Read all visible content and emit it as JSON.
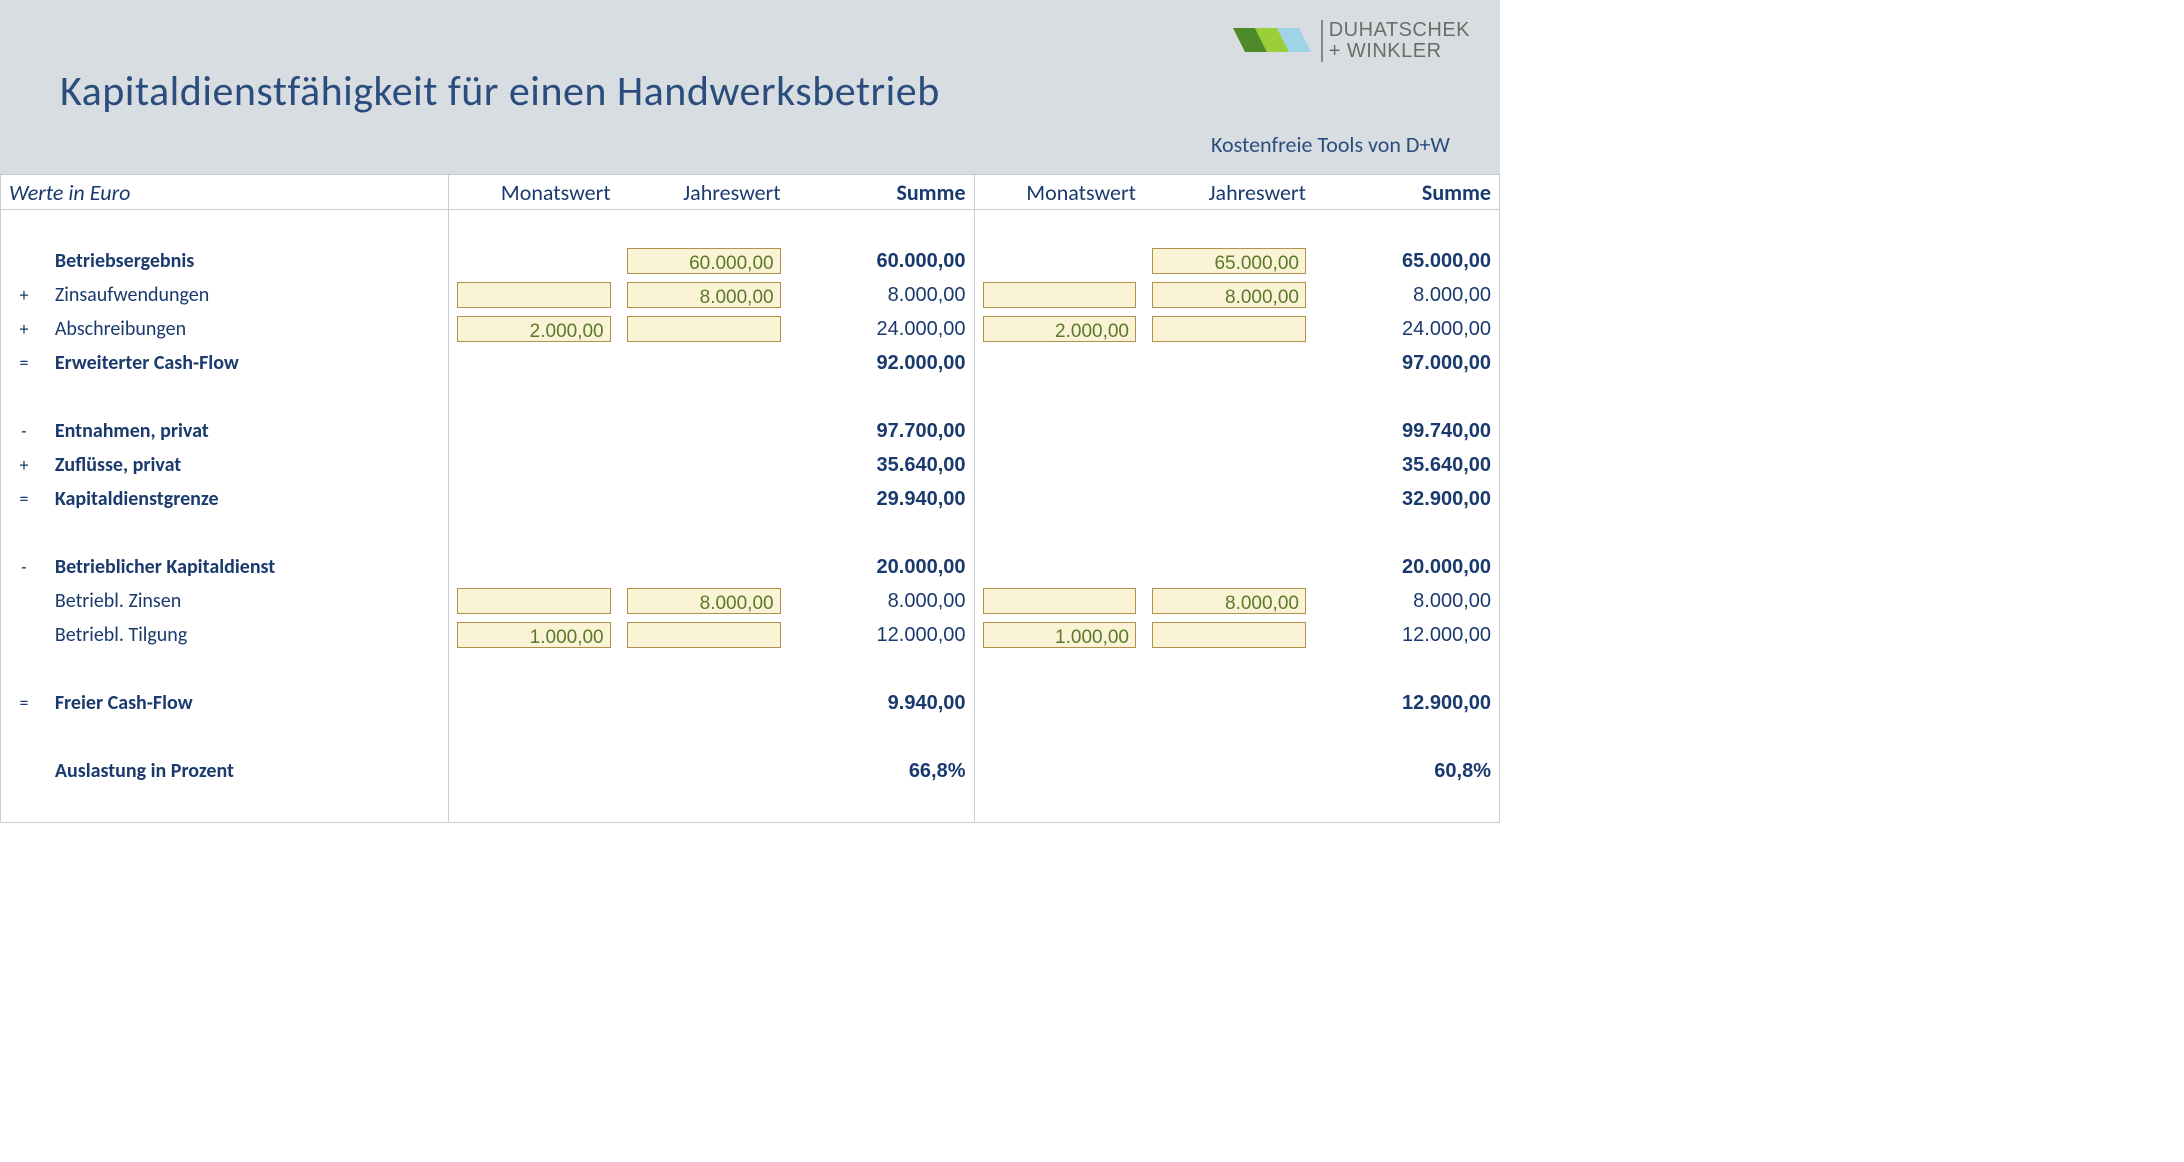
{
  "header": {
    "title": "Kapitaldienstfähigkeit für einen Handwerksbetrieb",
    "subtitle": "Kostenfreie Tools von D+W",
    "logo_line1": "DUHATSCHEK",
    "logo_line2": "+ WINKLER"
  },
  "columns": {
    "left_caption": "Werte in Euro",
    "monat": "Monatswert",
    "jahr": "Jahreswert",
    "summe": "Summe"
  },
  "rows": {
    "betriebsergebnis": {
      "op": "",
      "label": "Betriebsergebnis",
      "a": {
        "monat": "",
        "jahr": "60.000,00",
        "summe": "60.000,00"
      },
      "b": {
        "monat": "",
        "jahr": "65.000,00",
        "summe": "65.000,00"
      }
    },
    "zinsaufwendungen": {
      "op": "+",
      "label": "Zinsaufwendungen",
      "a": {
        "monat": "",
        "jahr": "8.000,00",
        "summe": "8.000,00"
      },
      "b": {
        "monat": "",
        "jahr": "8.000,00",
        "summe": "8.000,00"
      }
    },
    "abschreibungen": {
      "op": "+",
      "label": "Abschreibungen",
      "a": {
        "monat": "2.000,00",
        "jahr": "",
        "summe": "24.000,00"
      },
      "b": {
        "monat": "2.000,00",
        "jahr": "",
        "summe": "24.000,00"
      }
    },
    "erweiterter_cf": {
      "op": "=",
      "label": "Erweiterter Cash-Flow",
      "a": {
        "summe": "92.000,00"
      },
      "b": {
        "summe": "97.000,00"
      }
    },
    "entnahmen": {
      "op": "-",
      "label": "Entnahmen, privat",
      "a": {
        "summe": "97.700,00"
      },
      "b": {
        "summe": "99.740,00"
      }
    },
    "zufluesse": {
      "op": "+",
      "label": "Zuflüsse, privat",
      "a": {
        "summe": "35.640,00"
      },
      "b": {
        "summe": "35.640,00"
      }
    },
    "kapitaldienstgrenze": {
      "op": "=",
      "label": "Kapitaldienstgrenze",
      "a": {
        "summe": "29.940,00"
      },
      "b": {
        "summe": "32.900,00"
      }
    },
    "betr_kapitaldienst": {
      "op": "-",
      "label": "Betrieblicher Kapitaldienst",
      "a": {
        "summe": "20.000,00"
      },
      "b": {
        "summe": "20.000,00"
      }
    },
    "betr_zinsen": {
      "op": "",
      "label": "Betriebl. Zinsen",
      "a": {
        "monat": "",
        "jahr": "8.000,00",
        "summe": "8.000,00"
      },
      "b": {
        "monat": "",
        "jahr": "8.000,00",
        "summe": "8.000,00"
      }
    },
    "betr_tilgung": {
      "op": "",
      "label": "Betriebl. Tilgung",
      "a": {
        "monat": "1.000,00",
        "jahr": "",
        "summe": "12.000,00"
      },
      "b": {
        "monat": "1.000,00",
        "jahr": "",
        "summe": "12.000,00"
      }
    },
    "freier_cf": {
      "op": "=",
      "label": "Freier Cash-Flow",
      "a": {
        "summe": "9.940,00"
      },
      "b": {
        "summe": "12.900,00"
      }
    },
    "auslastung": {
      "op": "",
      "label": "Auslastung in Prozent",
      "a": {
        "summe": "66,8%"
      },
      "b": {
        "summe": "60,8%"
      }
    }
  }
}
